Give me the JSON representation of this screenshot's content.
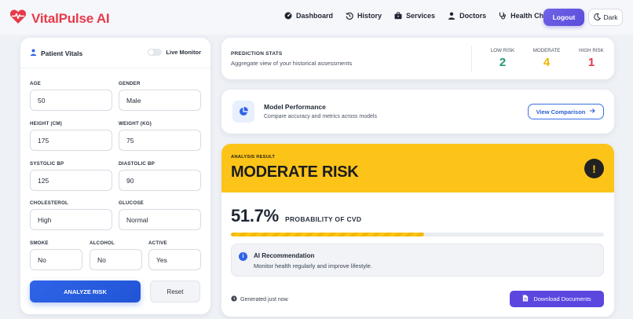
{
  "brand": {
    "name": "VitalPulse AI",
    "color": "#e63a4a"
  },
  "nav": {
    "links": [
      {
        "label": "Dashboard",
        "icon": "gauge-icon"
      },
      {
        "label": "History",
        "icon": "history-icon"
      },
      {
        "label": "Services",
        "icon": "briefcase-icon"
      },
      {
        "label": "Doctors",
        "icon": "user-icon"
      },
      {
        "label": "Health Check",
        "icon": "stethoscope-icon"
      }
    ],
    "logout": "Logout",
    "theme": "Dark"
  },
  "vitals": {
    "title": "Patient Vitals",
    "live_monitor": "Live Monitor",
    "live_monitor_on": false,
    "fields": {
      "age": {
        "label": "AGE",
        "value": "50"
      },
      "gender": {
        "label": "GENDER",
        "value": "Male"
      },
      "height": {
        "label": "HEIGHT (CM)",
        "value": "175"
      },
      "weight": {
        "label": "WEIGHT (KG)",
        "value": "75"
      },
      "systolic": {
        "label": "SYSTOLIC BP",
        "value": "125"
      },
      "diastolic": {
        "label": "DIASTOLIC BP",
        "value": "90"
      },
      "cholesterol": {
        "label": "CHOLESTEROL",
        "value": "High"
      },
      "glucose": {
        "label": "GLUCOSE",
        "value": "Normal"
      },
      "smoke": {
        "label": "SMOKE",
        "value": "No"
      },
      "alcohol": {
        "label": "ALCOHOL",
        "value": "No"
      },
      "active": {
        "label": "ACTIVE",
        "value": "Yes"
      }
    },
    "analyze": "ANALYZE RISK",
    "reset": "Reset"
  },
  "stats": {
    "title": "PREDICTION STATS",
    "subtitle": "Aggregate view of your historical assessments",
    "items": [
      {
        "label": "LOW RISK",
        "value": "2",
        "color": "#1f9d6b"
      },
      {
        "label": "MODERATE",
        "value": "4",
        "color": "#f2b600"
      },
      {
        "label": "HIGH RISK",
        "value": "1",
        "color": "#e0394a"
      }
    ]
  },
  "model": {
    "title": "Model Performance",
    "subtitle": "Compare accuracy and metrics across models",
    "button": "View Comparison"
  },
  "result": {
    "label": "ANALYSIS RESULT",
    "risk": "MODERATE RISK",
    "probability": "51.7%",
    "probability_fraction": 0.517,
    "probability_label": "PROBABILITY OF CVD",
    "recommendation_title": "AI Recommendation",
    "recommendation": "Monitor health regularly and improve lifestyle.",
    "generated": "Generated just now",
    "download": "Download Documents",
    "accent": "#fcc419"
  }
}
